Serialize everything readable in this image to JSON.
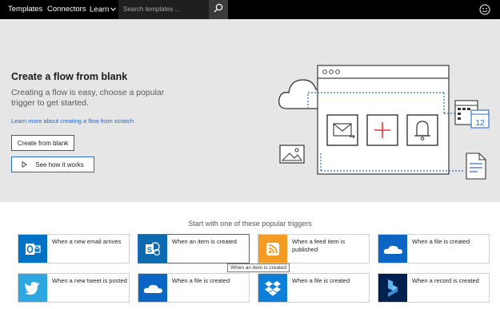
{
  "nav": {
    "templates": "Templates",
    "connectors": "Connectors",
    "learn": "Learn",
    "search_placeholder": "Search templates ..."
  },
  "hero": {
    "title": "Create a flow from blank",
    "subtitle": "Creating a flow is easy, choose a popular trigger to get started.",
    "learn_link": "Learn more about creating a flow from scratch",
    "create_button": "Create from blank",
    "see_button": "See how it works",
    "calendar_day": "12"
  },
  "triggers": {
    "heading": "Start with one of these popular triggers",
    "cards": [
      {
        "label": "When a new email arrives",
        "icon": "outlook-icon",
        "color": "#0072c6"
      },
      {
        "label": "When an item is created",
        "icon": "sharepoint-icon",
        "color": "#0b6ab0"
      },
      {
        "label": "When a feed item is published",
        "icon": "rss-icon",
        "color": "#f59a23"
      },
      {
        "label": "When a file is created",
        "icon": "onedrive-icon",
        "color": "#0a66c2"
      },
      {
        "label": "When a new tweet is posted",
        "icon": "twitter-icon",
        "color": "#2ea7e0"
      },
      {
        "label": "When a file is created",
        "icon": "onedrive-icon",
        "color": "#0a66c2"
      },
      {
        "label": "When a file is created",
        "icon": "dropbox-icon",
        "color": "#0d7fd8"
      },
      {
        "label": "When a record is created",
        "icon": "dynamics-icon",
        "color": "#002050"
      }
    ],
    "tooltip": "When an item is created"
  }
}
